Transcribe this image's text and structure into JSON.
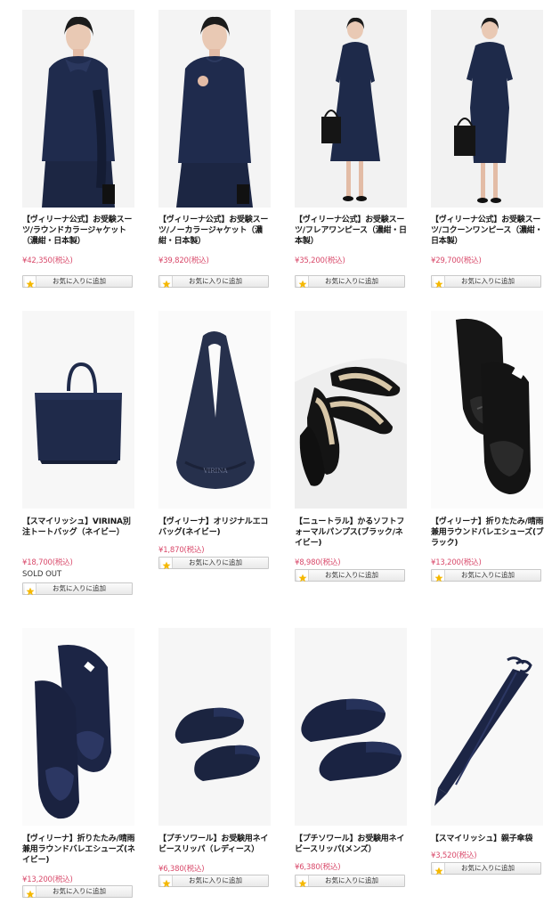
{
  "products": [
    {
      "title": "【ヴィリーナ公式】お受験スーツ/ラウンドカラージャケット（濃紺・日本製）",
      "price": "¥42,350(税込)",
      "sold_out": "",
      "icon": "navy-round-collar-jacket"
    },
    {
      "title": "【ヴィリーナ公式】お受験スーツ/ノーカラージャケット（濃紺・日本製）",
      "price": "¥39,820(税込)",
      "sold_out": "",
      "icon": "navy-collarless-jacket"
    },
    {
      "title": "【ヴィリーナ公式】お受験スーツ/フレアワンピース（濃紺・日本製）",
      "price": "¥35,200(税込)",
      "sold_out": "",
      "icon": "navy-flare-dress"
    },
    {
      "title": "【ヴィリーナ公式】お受験スーツ/コクーンワンピース（濃紺・日本製）",
      "price": "¥29,700(税込)",
      "sold_out": "",
      "icon": "navy-cocoon-dress"
    },
    {
      "title": "【スマイリッシュ】VIRINA別注トートバッグ（ネイビー）",
      "price": "¥18,700(税込)",
      "sold_out": "SOLD OUT",
      "icon": "navy-tote-bag"
    },
    {
      "title": "【ヴィリーナ】オリジナルエコバッグ(ネイビー)",
      "price": "¥1,870(税込)",
      "sold_out": "",
      "icon": "navy-eco-bag"
    },
    {
      "title": "【ニュートラル】かるソフトフォーマルパンプス(ブラック/ネイビー)",
      "price": "¥8,980(税込)",
      "sold_out": "",
      "icon": "black-pumps"
    },
    {
      "title": "【ヴィリーナ】折りたたみ/晴雨兼用ラウンドバレエシューズ(ブラック)",
      "price": "¥13,200(税込)",
      "sold_out": "",
      "icon": "black-ballet-shoes"
    },
    {
      "title": "【ヴィリーナ】折りたたみ/晴雨兼用ラウンドバレエシューズ(ネイビー)",
      "price": "¥13,200(税込)",
      "sold_out": "",
      "icon": "navy-ballet-shoes"
    },
    {
      "title": "【プチソワール】お受験用ネイビースリッパ（レディース）",
      "price": "¥6,380(税込)",
      "sold_out": "",
      "icon": "navy-slippers-ladies"
    },
    {
      "title": "【プチソワール】お受験用ネイビースリッパ(メンズ）",
      "price": "¥6,380(税込)",
      "sold_out": "",
      "icon": "navy-slippers-mens"
    },
    {
      "title": "【スマイリッシュ】親子傘袋",
      "price": "¥3,520(税込)",
      "sold_out": "",
      "icon": "navy-umbrella-bag"
    }
  ],
  "fav_label": "お気に入りに追加",
  "bag_logo": "VIRINA",
  "colors": {
    "price": "#d94a6b",
    "navy": "#1e2a4a",
    "star": "#f5b800"
  }
}
